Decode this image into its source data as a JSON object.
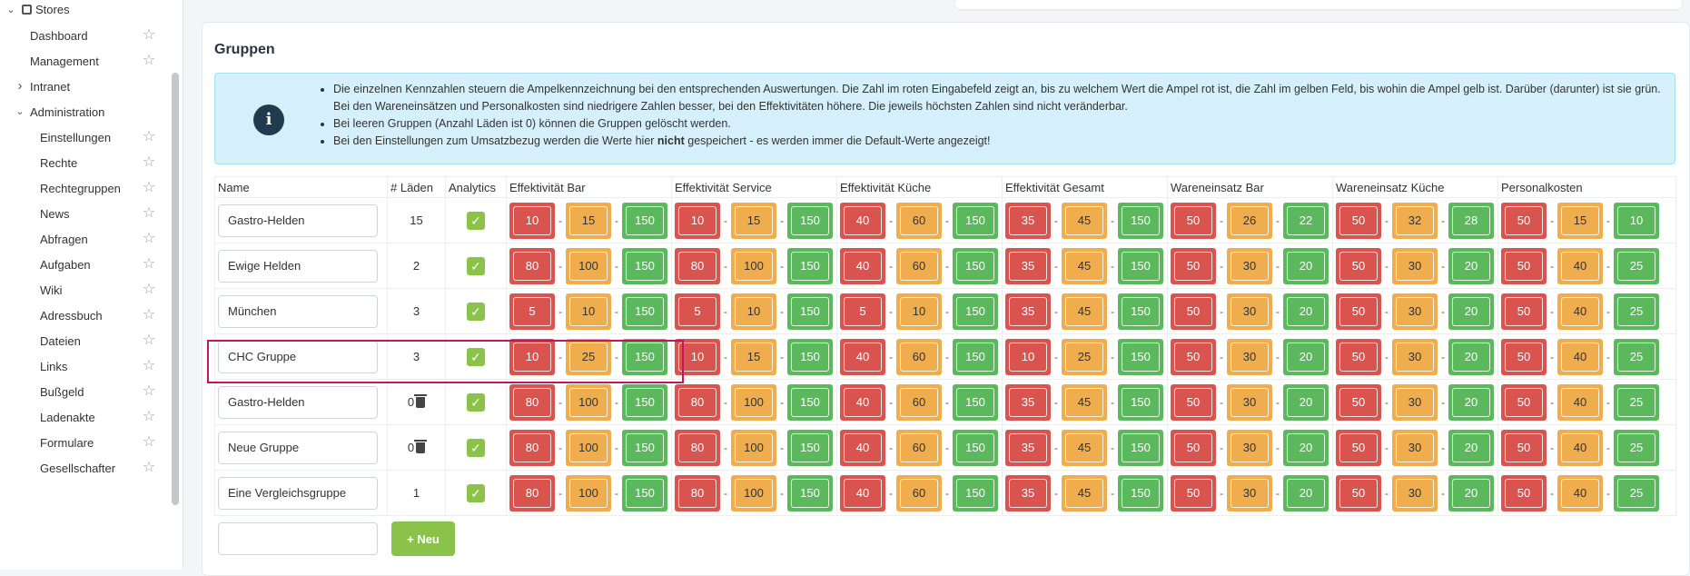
{
  "sidebar": {
    "stores_label": "Stores",
    "items": [
      {
        "label": "Dashboard",
        "level": 1
      },
      {
        "label": "Management",
        "level": 1
      },
      {
        "label": "Intranet",
        "level": 0
      },
      {
        "label": "Administration",
        "level": 0
      },
      {
        "label": "Einstellungen",
        "level": 2
      },
      {
        "label": "Rechte",
        "level": 2
      },
      {
        "label": "Rechtegruppen",
        "level": 2
      },
      {
        "label": "News",
        "level": 2
      },
      {
        "label": "Abfragen",
        "level": 2
      },
      {
        "label": "Aufgaben",
        "level": 2
      },
      {
        "label": "Wiki",
        "level": 2
      },
      {
        "label": "Adressbuch",
        "level": 2
      },
      {
        "label": "Dateien",
        "level": 2
      },
      {
        "label": "Links",
        "level": 2
      },
      {
        "label": "Bußgeld",
        "level": 2
      },
      {
        "label": "Ladenakte",
        "level": 2
      },
      {
        "label": "Formulare",
        "level": 2
      },
      {
        "label": "Gesellschafter",
        "level": 2
      }
    ]
  },
  "page": {
    "title": "Gruppen"
  },
  "info": {
    "line1": "Die einzelnen Kennzahlen steuern die Ampelkennzeichnung bei den entsprechenden Auswertungen. Die Zahl im roten Eingabefeld zeigt an, bis zu welchem Wert die Ampel rot ist, die Zahl im gelben Feld, bis wohin die Ampel gelb ist. Darüber (darunter) ist sie grün. Bei den Wareneinsätzen und Personalkosten sind niedrigere Zahlen besser, bei den Effektivitäten höhere. Die jeweils höchsten Zahlen sind nicht veränderbar.",
    "line2": "Bei leeren Gruppen (Anzahl Läden ist 0) können die Gruppen gelöscht werden.",
    "line3_pre": "Bei den Einstellungen zum Umsatzbezug werden die Werte hier ",
    "line3_bold": "nicht",
    "line3_post": " gespeichert - es werden immer die Default-Werte angezeigt!"
  },
  "table": {
    "headers": [
      "Name",
      "# Läden",
      "Analytics",
      "Effektivität Bar",
      "Effektivität Service",
      "Effektivität Küche",
      "Effektivität Gesamt",
      "Wareneinsatz Bar",
      "Wareneinsatz Küche",
      "Personalkosten"
    ],
    "rows": [
      {
        "name": "Gastro-Helden",
        "count": "15",
        "deletable": false,
        "analytics": true,
        "values": [
          [
            "10",
            "15",
            "150"
          ],
          [
            "10",
            "15",
            "150"
          ],
          [
            "40",
            "60",
            "150"
          ],
          [
            "35",
            "45",
            "150"
          ],
          [
            "50",
            "26",
            "22"
          ],
          [
            "50",
            "32",
            "28"
          ],
          [
            "50",
            "15",
            "10"
          ]
        ]
      },
      {
        "name": "Ewige Helden",
        "count": "2",
        "deletable": false,
        "analytics": true,
        "values": [
          [
            "80",
            "100",
            "150"
          ],
          [
            "80",
            "100",
            "150"
          ],
          [
            "40",
            "60",
            "150"
          ],
          [
            "35",
            "45",
            "150"
          ],
          [
            "50",
            "30",
            "20"
          ],
          [
            "50",
            "30",
            "20"
          ],
          [
            "50",
            "40",
            "25"
          ]
        ]
      },
      {
        "name": "München",
        "count": "3",
        "deletable": false,
        "analytics": true,
        "values": [
          [
            "5",
            "10",
            "150"
          ],
          [
            "5",
            "10",
            "150"
          ],
          [
            "5",
            "10",
            "150"
          ],
          [
            "35",
            "45",
            "150"
          ],
          [
            "50",
            "30",
            "20"
          ],
          [
            "50",
            "30",
            "20"
          ],
          [
            "50",
            "40",
            "25"
          ]
        ]
      },
      {
        "name": "CHC Gruppe",
        "count": "3",
        "deletable": false,
        "analytics": true,
        "values": [
          [
            "10",
            "25",
            "150"
          ],
          [
            "10",
            "15",
            "150"
          ],
          [
            "40",
            "60",
            "150"
          ],
          [
            "10",
            "25",
            "150"
          ],
          [
            "50",
            "30",
            "20"
          ],
          [
            "50",
            "30",
            "20"
          ],
          [
            "50",
            "40",
            "25"
          ]
        ]
      },
      {
        "name": "Gastro-Helden",
        "count": "0",
        "deletable": true,
        "analytics": true,
        "values": [
          [
            "80",
            "100",
            "150"
          ],
          [
            "80",
            "100",
            "150"
          ],
          [
            "40",
            "60",
            "150"
          ],
          [
            "35",
            "45",
            "150"
          ],
          [
            "50",
            "30",
            "20"
          ],
          [
            "50",
            "30",
            "20"
          ],
          [
            "50",
            "40",
            "25"
          ]
        ]
      },
      {
        "name": "Neue Gruppe",
        "count": "0",
        "deletable": true,
        "analytics": true,
        "values": [
          [
            "80",
            "100",
            "150"
          ],
          [
            "80",
            "100",
            "150"
          ],
          [
            "40",
            "60",
            "150"
          ],
          [
            "35",
            "45",
            "150"
          ],
          [
            "50",
            "30",
            "20"
          ],
          [
            "50",
            "30",
            "20"
          ],
          [
            "50",
            "40",
            "25"
          ]
        ]
      },
      {
        "name": "Eine Vergleichsgruppe",
        "count": "1",
        "deletable": false,
        "analytics": true,
        "values": [
          [
            "80",
            "100",
            "150"
          ],
          [
            "80",
            "100",
            "150"
          ],
          [
            "40",
            "60",
            "150"
          ],
          [
            "35",
            "45",
            "150"
          ],
          [
            "50",
            "30",
            "20"
          ],
          [
            "50",
            "30",
            "20"
          ],
          [
            "50",
            "40",
            "25"
          ]
        ]
      }
    ],
    "separator": "-",
    "new_button_label": "+ Neu",
    "new_name_value": ""
  },
  "colors": {
    "red": "#d9534f",
    "yellow": "#f0ad4e",
    "green": "#5cb85c",
    "accent": "#8bc34a",
    "highlight": "#c2185b"
  }
}
